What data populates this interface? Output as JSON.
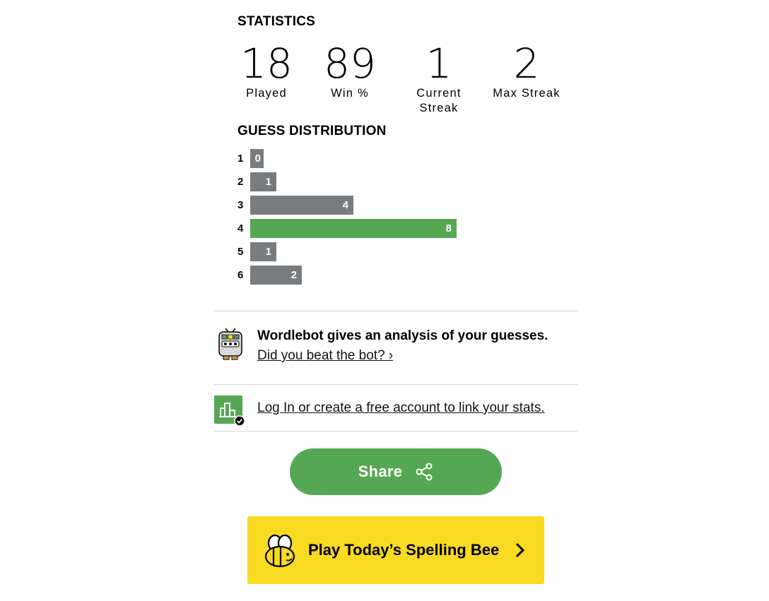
{
  "statistics": {
    "heading": "STATISTICS",
    "items": [
      {
        "value": "18",
        "label": "Played"
      },
      {
        "value": "89",
        "label": "Win %"
      },
      {
        "value": "1",
        "label": "Current Streak"
      },
      {
        "value": "2",
        "label": "Max Streak"
      }
    ]
  },
  "guess_distribution": {
    "heading": "GUESS DISTRIBUTION",
    "current_guess": "4",
    "rows": [
      {
        "guess": "1",
        "count": "0",
        "count_value": 0
      },
      {
        "guess": "2",
        "count": "1",
        "count_value": 1
      },
      {
        "guess": "3",
        "count": "4",
        "count_value": 4
      },
      {
        "guess": "4",
        "count": "8",
        "count_value": 8
      },
      {
        "guess": "5",
        "count": "1",
        "count_value": 1
      },
      {
        "guess": "6",
        "count": "2",
        "count_value": 2
      }
    ]
  },
  "wordlebot": {
    "title": "Wordlebot gives an analysis of your guesses.",
    "link": "Did you beat the bot? ›",
    "icon": "robot-icon"
  },
  "login": {
    "link": "Log In or create a free account to link your stats.",
    "icon": "stats-chart-badge-icon"
  },
  "share": {
    "label": "Share",
    "icon": "share-icon"
  },
  "spelling_bee": {
    "label": "Play Today’s Spelling Bee",
    "icon": "bee-icon",
    "chevron": "chevron-right-icon"
  },
  "colors": {
    "bar_default": "#787c7e",
    "bar_current": "#56a754",
    "share_button": "#56a754",
    "spelling_bee_button": "#f7da21"
  }
}
